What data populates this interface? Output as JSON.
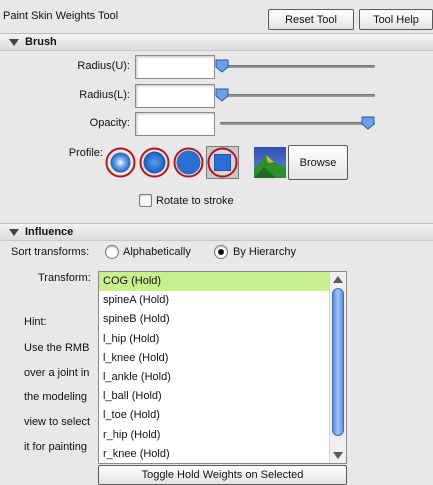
{
  "window": {
    "title": "Paint Skin Weights Tool"
  },
  "header": {
    "reset_label": "Reset Tool",
    "help_label": "Tool Help"
  },
  "brush": {
    "section_label": "Brush",
    "radius_u_label": "Radius(U):",
    "radius_l_label": "Radius(L):",
    "opacity_label": "Opacity:",
    "radius_u_value": "",
    "radius_l_value": "",
    "opacity_value": "",
    "radius_u_slider_fraction": 0.02,
    "radius_l_slider_fraction": 0.02,
    "opacity_slider_fraction": 0.98,
    "profile_label": "Profile:",
    "profiles": [
      "gaussian-brush",
      "soft-brush",
      "solid-brush",
      "square-brush"
    ],
    "selected_profile": "square-brush",
    "browse_label": "Browse",
    "rotate_label": "Rotate to stroke",
    "rotate_checked": false
  },
  "influence": {
    "section_label": "Influence",
    "sort_label": "Sort transforms:",
    "sort_options": [
      "Alphabetically",
      "By Hierarchy"
    ],
    "sort_selected": "By Hierarchy",
    "transform_label": "Transform:",
    "transforms": [
      "COG (Hold)",
      "spineA (Hold)",
      "spineB (Hold)",
      "l_hip (Hold)",
      "l_knee (Hold)",
      "l_ankle (Hold)",
      "l_ball (Hold)",
      "l_toe (Hold)",
      "r_hip (Hold)",
      "r_knee (Hold)"
    ],
    "selected_index": 0,
    "hint_lines": [
      "Hint:",
      "Use the RMB",
      "over a joint in",
      "the modeling",
      "view to select",
      "it for painting"
    ],
    "toggle_label": "Toggle Hold Weights on Selected"
  },
  "colors": {
    "selection": "#c8f08c",
    "accent_blue": "#2a6fd0",
    "profile_ring": "#b01818"
  }
}
